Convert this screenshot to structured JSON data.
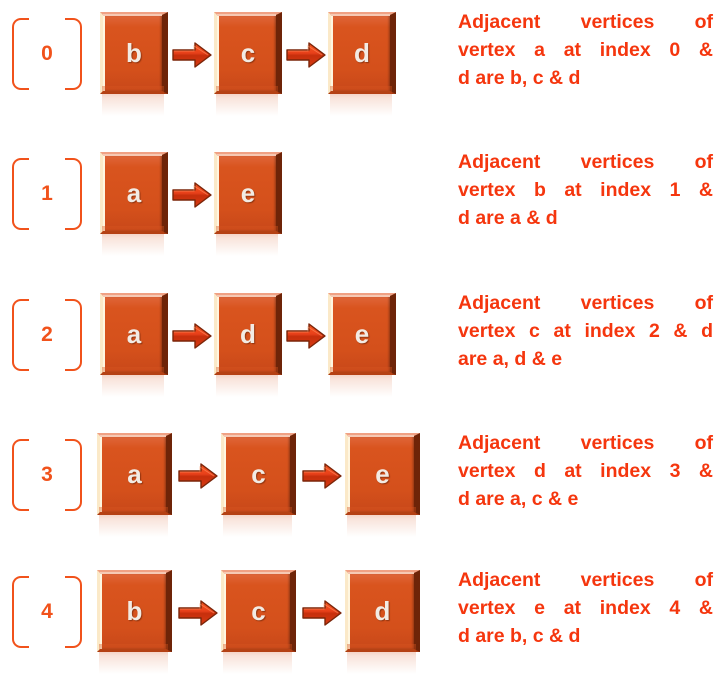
{
  "title": "Adjacency list representation rows",
  "colors": {
    "box_fill": "#D9541E",
    "box_left_highlight": "#FBE9C8",
    "box_right_shadow": "#6E2408",
    "arrow": "#E8401A",
    "arrow_outline": "#7A2509",
    "text": "#F5360E",
    "bracket": "#F1521B",
    "node_label": "#F2EBE4",
    "background": "#FFFFFF"
  },
  "rows": [
    {
      "index": "0",
      "nodes": [
        "b",
        "c",
        "d"
      ],
      "arrow_icon": "right-arrow-icon",
      "description_lines": [
        "Adjacent  vertices  of",
        "vertex a at index 0 &",
        "d are b, c & d"
      ],
      "description": "Adjacent vertices of vertex a at index 0 & d are b, c & d"
    },
    {
      "index": "1",
      "nodes": [
        "a",
        "e"
      ],
      "arrow_icon": "right-arrow-icon",
      "description_lines": [
        "Adjacent  vertices  of",
        "vertex b at index 1 &",
        "d are a & d"
      ],
      "description": "Adjacent vertices of vertex b at index 1 & d are a & d"
    },
    {
      "index": "2",
      "nodes": [
        "a",
        "d",
        "e"
      ],
      "arrow_icon": "right-arrow-icon",
      "description_lines": [
        "Adjacent   vertices   of",
        "vertex c at index 2 & d",
        "are a, d & e"
      ],
      "description": "Adjacent vertices of vertex c at index 2 & d are a, d & e"
    },
    {
      "index": "3",
      "nodes": [
        "a",
        "c",
        "e"
      ],
      "arrow_icon": "right-arrow-icon",
      "description_lines": [
        "Adjacent  vertices  of",
        "vertex d at index 3 &",
        "d are a, c & e"
      ],
      "description": "Adjacent vertices of vertex d at index 3 & d are a, c & e"
    },
    {
      "index": "4",
      "nodes": [
        "b",
        "c",
        "d"
      ],
      "arrow_icon": "right-arrow-icon",
      "description_lines": [
        "Adjacent  vertices  of",
        "vertex e at index 4 &",
        "d are b, c & d"
      ],
      "description": "Adjacent vertices of vertex e at index 4 & d are b, c & d"
    }
  ]
}
